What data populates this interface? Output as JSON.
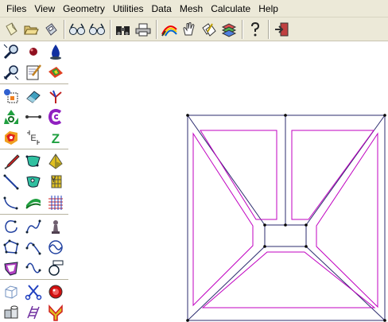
{
  "menu": {
    "items": [
      "Files",
      "View",
      "Geometry",
      "Utilities",
      "Data",
      "Mesh",
      "Calculate",
      "Help"
    ]
  },
  "toolbar": {
    "icons": [
      "new-file-icon",
      "open-folder-icon",
      "save-disk-icon",
      "zoom-glasses-icon",
      "zoom-glasses-alt-icon",
      "binoculars-icon",
      "printer-icon",
      "color-rainbow-icon",
      "hand-pan-icon",
      "edit-pages-icon",
      "layers-stack-icon",
      "help-question-icon",
      "exit-door-icon"
    ]
  },
  "palette": {
    "icons": [
      "zoom-in-icon",
      "point-red-icon",
      "drop-blue-icon",
      "zoom-out-icon",
      "notepad-edit-icon",
      "surface-color-icon",
      "select-box-icon",
      "eraser-icon",
      "axes-icon",
      "recycle-icon",
      "dimension-line-icon",
      "spiral-c-icon",
      "colorize-icon",
      "label-e-icon",
      "label-z-icon",
      "pencil-red-icon",
      "surface-green-icon",
      "cone-yellow-icon",
      "line-blue-icon",
      "surface-green-dot-icon",
      "mesh-yellow-icon",
      "arc-icon",
      "sweep-green-icon",
      "grid-red-icon",
      "circle-arc-icon",
      "curve-blue-icon",
      "pawn-icon",
      "polygon-icon",
      "curve-nodes-icon",
      "wave-blue-icon",
      "polygon-filled-icon",
      "curve-s-icon",
      "cylinder-icon",
      "cube-wire-icon",
      "scissors-icon",
      "sphere-red-icon",
      "stack-objects-icon",
      "ladder-icon",
      "y-shape-icon"
    ]
  },
  "colors": {
    "frame": "#2b2b6e",
    "offset": "#c000c0",
    "node": "#000000",
    "chrome": "#ece9d8"
  }
}
